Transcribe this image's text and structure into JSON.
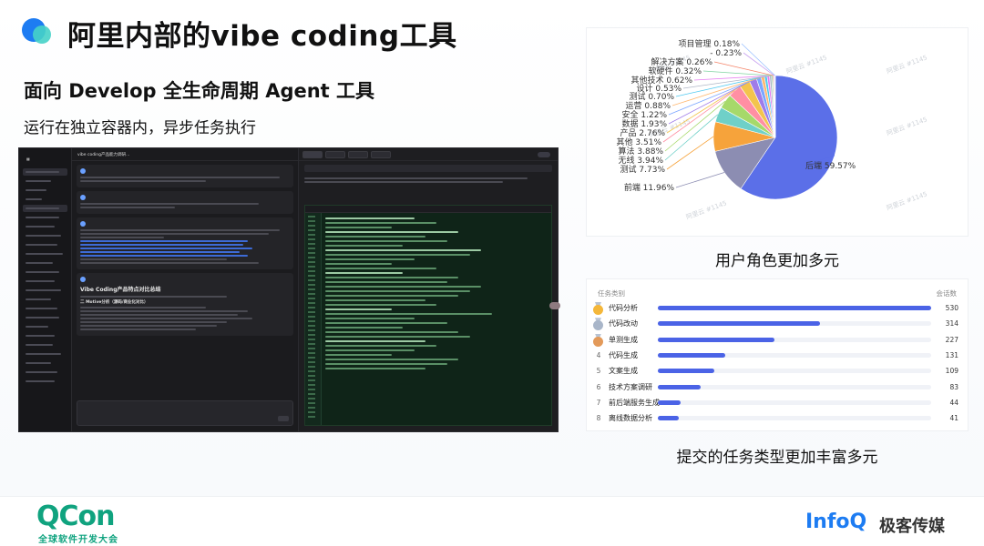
{
  "header": {
    "title": "阿里内部的vibe coding工具",
    "subtitle": "面向 Develop 全生命周期 Agent 工具",
    "description": "运行在独立容器内，异步任务执行"
  },
  "app_screenshot": {
    "chat_title": "vibe coding产品能力调研...",
    "message_heading": "Vibe Coding产品特点对比总结",
    "message_subheading": "二 Motive分析（源码/商业化对比）"
  },
  "pie_chart": {
    "caption": "用户角色更加多元",
    "watermark": "阿里云 #1145",
    "chart_data": {
      "type": "pie",
      "slices": [
        {
          "label": "后端",
          "value": 59.57,
          "color": "#5b6fe8"
        },
        {
          "label": "前端",
          "value": 11.96,
          "color": "#8c8db2"
        },
        {
          "label": "测试",
          "value": 7.73,
          "color": "#f6a33b"
        },
        {
          "label": "无线",
          "value": 3.94,
          "color": "#6fd0c8"
        },
        {
          "label": "算法",
          "value": 3.88,
          "color": "#a6d96a"
        },
        {
          "label": "其他",
          "value": 3.51,
          "color": "#ff8fa3"
        },
        {
          "label": "产品",
          "value": 2.76,
          "color": "#f3c44d"
        },
        {
          "label": "数据",
          "value": 1.93,
          "color": "#9f7ce9"
        },
        {
          "label": "安全",
          "value": 1.22,
          "color": "#7aa6ff"
        },
        {
          "label": "运营",
          "value": 0.88,
          "color": "#ffb870"
        },
        {
          "label": "测试",
          "value": 0.7,
          "color": "#4fc9f0"
        },
        {
          "label": "其他技术",
          "value": 0.62,
          "color": "#e57ef0"
        },
        {
          "label": "设计",
          "value": 0.53,
          "color": "#b0b7c7"
        },
        {
          "label": "软硬件",
          "value": 0.32,
          "color": "#7fd4a1"
        },
        {
          "label": "解决方案",
          "value": 0.26,
          "color": "#f5856a"
        },
        {
          "label": "",
          "value": 0.23,
          "color": "#c8a2f0"
        },
        {
          "label": "项目管理",
          "value": 0.18,
          "color": "#9bc1ff"
        }
      ],
      "labels_text": [
        "后端 59.57%",
        "前端 11.96%",
        "测试 7.73%",
        "无线 3.94%",
        "算法 3.88%",
        "其他 3.51%",
        "产品 2.76%",
        "数据 1.93%",
        "安全 1.22%",
        "运营 0.88%",
        "测试 0.70%",
        "其他技术 0.62%",
        "设计 0.53%",
        "软硬件 0.32%",
        "解决方案 0.26%",
        "- 0.23%",
        "项目管理 0.18%"
      ]
    }
  },
  "task_table": {
    "caption": "提交的任务类型更加丰富多元",
    "col_type": "任务类别",
    "col_count": "会话数",
    "chart_data": {
      "type": "bar",
      "categories": [
        "代码分析",
        "代码改动",
        "单测生成",
        "代码生成",
        "文案生成",
        "技术方案调研",
        "前后端服务生成",
        "离线数据分析"
      ],
      "values": [
        530,
        314,
        227,
        131,
        109,
        83,
        44,
        41
      ],
      "xlim": [
        0,
        530
      ]
    },
    "ranks": [
      "1",
      "2",
      "3",
      "4",
      "5",
      "6",
      "7",
      "8"
    ],
    "medal_colors": [
      "#f4b73a",
      "#a9b6c9",
      "#e39a5a"
    ]
  },
  "footer": {
    "qcon": "QCon",
    "qcon_sub": "全球软件开发大会",
    "infoq": "InfoQ",
    "geek": "极客传媒"
  }
}
